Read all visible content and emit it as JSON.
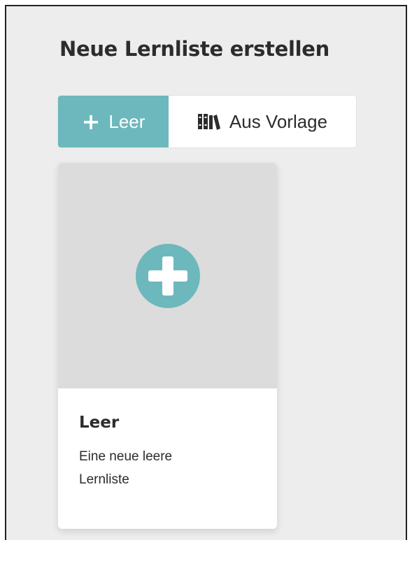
{
  "page": {
    "title": "Neue Lernliste erstellen"
  },
  "toggle": {
    "blank": {
      "label": "Leer",
      "icon": "plus-icon",
      "active": true
    },
    "template": {
      "label": "Aus Vorlage",
      "icon": "books-icon",
      "active": false
    }
  },
  "card": {
    "title": "Leer",
    "description": "Eine neue leere Lernliste",
    "icon": "plus-circle-icon"
  },
  "colors": {
    "accent": "#6db8bc",
    "background": "#ededed",
    "card_image_bg": "#dcdcdc",
    "text": "#2c2c2c"
  }
}
